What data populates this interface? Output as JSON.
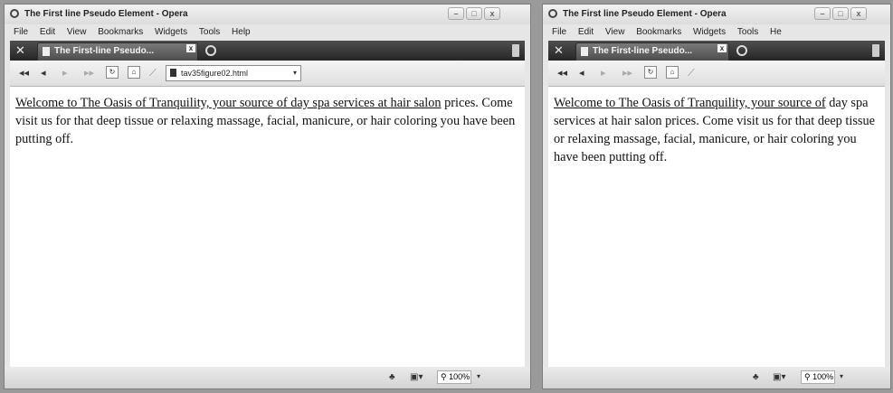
{
  "left_window": {
    "title": "The First line Pseudo Element - Opera",
    "window_buttons": [
      "–",
      "□",
      "x"
    ],
    "menu": [
      "File",
      "Edit",
      "View",
      "Bookmarks",
      "Widgets",
      "Tools",
      "Help"
    ],
    "tab_label": "The First-line Pseudo...",
    "address": "tav35figure02.html",
    "content": {
      "first_line": "Welcome to The Oasis of Tranquility, your source of day spa services at hair salon",
      "rest": " prices. Come visit us for that deep tissue or relaxing massage, facial, manicure, or hair coloring you have been putting off."
    },
    "zoom": "100%"
  },
  "right_window": {
    "title": "The First line Pseudo Element - Opera",
    "window_buttons": [
      "–",
      "□",
      "x"
    ],
    "menu": [
      "File",
      "Edit",
      "View",
      "Bookmarks",
      "Widgets",
      "Tools",
      "He"
    ],
    "tab_label": "The First-line Pseudo...",
    "content": {
      "first_line": "Welcome to The Oasis of Tranquility, your source of",
      "rest": " day spa services at hair salon prices. Come visit us for that deep tissue or relaxing massage, facial, manicure, or hair coloring you have been putting off."
    },
    "zoom": "100%"
  },
  "icons": {
    "back": "◂◂",
    "forward_left": "◂",
    "forward_right": "▸",
    "fast_forward": "▸▸",
    "reload": "↻",
    "home": "⌂",
    "wand": "⟋",
    "new_tab": "○",
    "status_dragon": "♣",
    "status_images": "▣▾",
    "zoom_search": "⚲",
    "dropdown": "▾"
  }
}
